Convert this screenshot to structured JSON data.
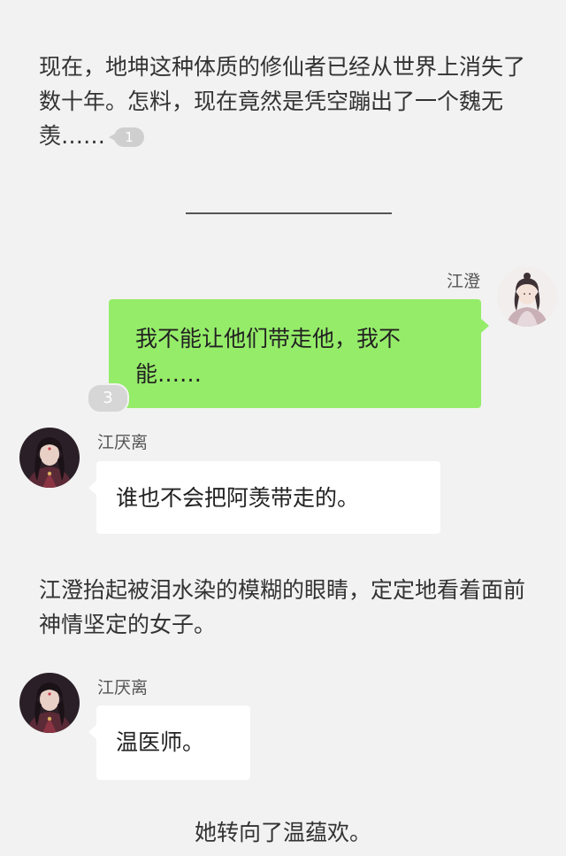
{
  "story": {
    "para1": "现在，地坤这种体质的修仙者已经从世界上消失了数十年。怎料，现在竟然是凭空蹦出了一个魏无羡……",
    "para1_badge": "1",
    "para2": "江澄抬起被泪水染的模糊的眼睛，定定地看着面前神情坚定的女子。",
    "para3": "她转向了温蕴欢。"
  },
  "messages": [
    {
      "sender": "江澄",
      "side": "right",
      "text": "我不能让他们带走他，我不能……",
      "badge": "3"
    },
    {
      "sender": "江厌离",
      "side": "left",
      "text": "谁也不会把阿羡带走的。"
    },
    {
      "sender": "江厌离",
      "side": "left",
      "text": "温医师。"
    }
  ],
  "colors": {
    "background": "#f2f2f2",
    "outgoing_bubble": "#95ec69",
    "incoming_bubble": "#ffffff",
    "badge": "#d6d6d6"
  },
  "icons": {
    "avatar_right": "jiang-cheng-avatar",
    "avatar_left": "jiang-yanli-avatar"
  }
}
